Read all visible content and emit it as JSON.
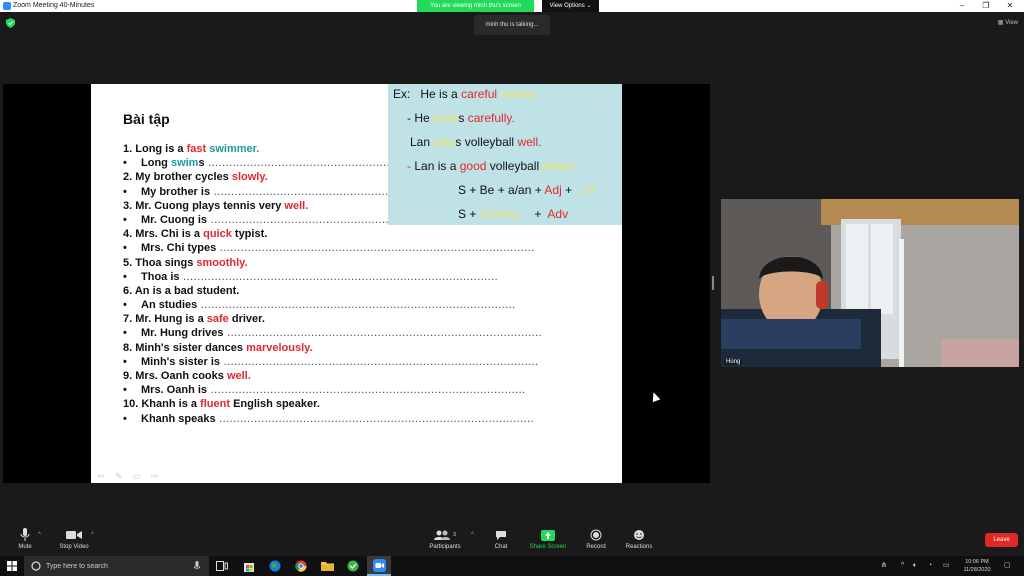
{
  "window": {
    "title": "Zoom Meeting 40-Minutes",
    "viewing_banner": "You are viewing minh thu's screen",
    "view_options": "View Options",
    "talking_indicator": "minh thu is talking...",
    "view_button": "View"
  },
  "slide": {
    "title": "Bài tập",
    "example_box": {
      "line1": {
        "prefix": "Ex:",
        "text": "He is a",
        "red": "careful",
        "yellow": "worker."
      },
      "line2": {
        "dash": "- He",
        "yellow": "work",
        "mid": "s",
        "red": "carefully."
      },
      "line3": {
        "text1": "Lan",
        "yellow": "play",
        "text2": "s volleyball",
        "red": "well."
      },
      "line4": {
        "dash": "-",
        "text1": "Lan is a",
        "red": "good",
        "text2": "volleyball",
        "yellow": "player."
      },
      "formula1": {
        "text": "S + Be + a/an +",
        "red": "Adj",
        "text2": "+",
        "yellow": "...N"
      },
      "formula2": {
        "text": "S +",
        "yellow": "V(s/es)...",
        "text2": "+",
        "red": "Adv"
      }
    },
    "exercises": [
      {
        "num": "1.",
        "before": "Long is a",
        "highlight": "fast",
        "after": "",
        "teal": "swimmer.",
        "answer_start": "Long",
        "answer_teal": "swim",
        "answer_after": "s"
      },
      {
        "num": "2.",
        "before": "My brother cycles",
        "highlight": "slowly.",
        "after": "",
        "answer_start": "My brother is"
      },
      {
        "num": "3.",
        "before": "Mr. Cuong plays tennis very",
        "highlight": "well.",
        "after": "",
        "answer_start": "Mr. Cuong is"
      },
      {
        "num": "4.",
        "before": "Mrs. Chi is a",
        "highlight": "quick",
        "after": "typist.",
        "answer_start": "Mrs. Chi types"
      },
      {
        "num": "5.",
        "before": "Thoa sings",
        "highlight": "smoothly.",
        "after": "",
        "answer_start": "Thoa is"
      },
      {
        "num": "6.",
        "before": "An is a bad student.",
        "highlight": "",
        "after": "",
        "answer_start": "An studies"
      },
      {
        "num": "7.",
        "before": "Mr. Hung is a",
        "highlight": "safe",
        "after": "driver.",
        "answer_start": "Mr. Hung drives"
      },
      {
        "num": "8.",
        "before": "Minh's sister dances",
        "highlight": "marvelously.",
        "after": "",
        "answer_start": "Minh's sister is"
      },
      {
        "num": "9.",
        "before": "Mrs. Oanh cooks",
        "highlight": "well.",
        "after": "",
        "answer_start": "Mrs. Oanh is"
      },
      {
        "num": "10.",
        "before": "Khanh is a",
        "highlight": "fluent",
        "after": "English speaker.",
        "answer_start": "Khanh speaks"
      }
    ],
    "bullet": "•",
    "dots": "………………………………………………………………………………"
  },
  "video": {
    "participant_name": "Hùng"
  },
  "toolbar": {
    "mute": "Mute",
    "stop_video": "Stop Video",
    "participants": "Participants",
    "participants_count": "3",
    "chat": "Chat",
    "share_screen": "Share Screen",
    "record": "Record",
    "reactions": "Reactions",
    "leave": "Leave"
  },
  "taskbar": {
    "search_placeholder": "Type here to search",
    "time": "10:06 PM",
    "date": "11/28/2020"
  },
  "colors": {
    "zoom_green": "#23d959",
    "leave_red": "#e02828",
    "slide_red": "#e0282e",
    "slide_teal": "#1a9c9c",
    "example_bg": "#bfe2e6",
    "example_yellow": "#f2e46a"
  }
}
